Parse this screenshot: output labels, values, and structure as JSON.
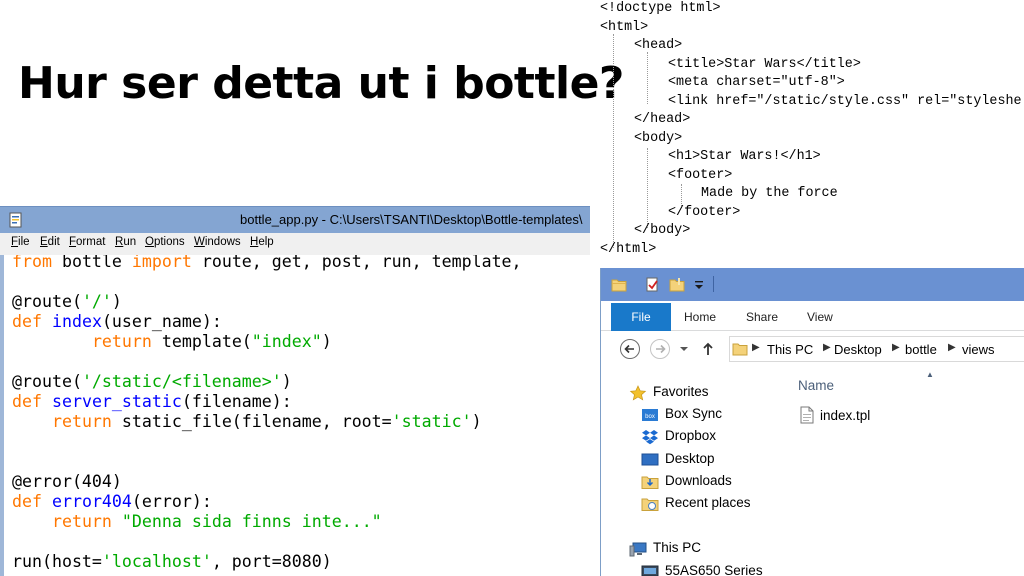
{
  "slide": {
    "title": "Hur ser detta ut i bottle?"
  },
  "html_code": {
    "lines": [
      "<!doctype html>",
      "<html>",
      "<head>",
      "<title>Star Wars</title>",
      "<meta charset=\"utf-8\">",
      "<link href=\"/static/style.css\" rel=\"styleshe",
      "</head>",
      "<body>",
      "<h1>Star Wars!</h1>",
      "<footer>",
      "Made by the force",
      "</footer>",
      "</body>",
      "</html>"
    ]
  },
  "idle": {
    "window_title": "bottle_app.py - C:\\Users\\TSANTI\\Desktop\\Bottle-templates\\",
    "menu": [
      {
        "underline": "F",
        "rest": "ile"
      },
      {
        "underline": "E",
        "rest": "dit"
      },
      {
        "underline": "F",
        "rest": "ormat"
      },
      {
        "underline": "R",
        "rest": "un"
      },
      {
        "underline": "O",
        "rest": "ptions"
      },
      {
        "underline": "W",
        "rest": "indows"
      },
      {
        "underline": "H",
        "rest": "elp"
      }
    ],
    "code": {
      "l1": {
        "k1": "from",
        "t1": " bottle ",
        "k2": "import",
        "t2": " route, get, post, run, template, "
      },
      "l3": {
        "t1": "@route(",
        "s1": "'/'",
        "t2": ")"
      },
      "l4": {
        "k1": "def",
        "t1": " ",
        "f1": "index",
        "t2": "(user_name):"
      },
      "l5": {
        "t0": "        ",
        "k1": "return",
        "t1": " template(",
        "s1": "\"index\"",
        "t2": ")"
      },
      "l7": {
        "t1": "@route(",
        "s1": "'/static/<filename>'",
        "t2": ")"
      },
      "l8": {
        "k1": "def",
        "t1": " ",
        "f1": "server_static",
        "t2": "(filename):"
      },
      "l9": {
        "t0": "    ",
        "k1": "return",
        "t1": " static_file(filename, root=",
        "s1": "'static'",
        "t2": ")"
      },
      "l12": {
        "t1": "@error(404)"
      },
      "l13": {
        "k1": "def",
        "t1": " ",
        "f1": "error404",
        "t2": "(error):"
      },
      "l14": {
        "t0": "    ",
        "k1": "return",
        "t1": " ",
        "s1": "\"Denna sida finns inte...\""
      },
      "l16": {
        "t1": "run(host=",
        "s1": "'localhost'",
        "t2": ", port=8080)"
      }
    }
  },
  "explorer": {
    "ribbon": {
      "file": "File",
      "home": "Home",
      "share": "Share",
      "view": "View"
    },
    "breadcrumb": [
      "This PC",
      "Desktop",
      "bottle",
      "views"
    ],
    "nav_items": [
      "Favorites",
      "Box Sync",
      "Dropbox",
      "Desktop",
      "Downloads",
      "Recent places",
      "This PC",
      "55AS650 Series"
    ],
    "column_header": "Name",
    "files": [
      "index.tpl"
    ]
  },
  "colors": {
    "idle_keyword": "#ff7700",
    "idle_function": "#0000ff",
    "idle_string": "#00aa00",
    "idle_titlebar": "#84a5d2",
    "explorer_file_tab": "#1979ca"
  }
}
